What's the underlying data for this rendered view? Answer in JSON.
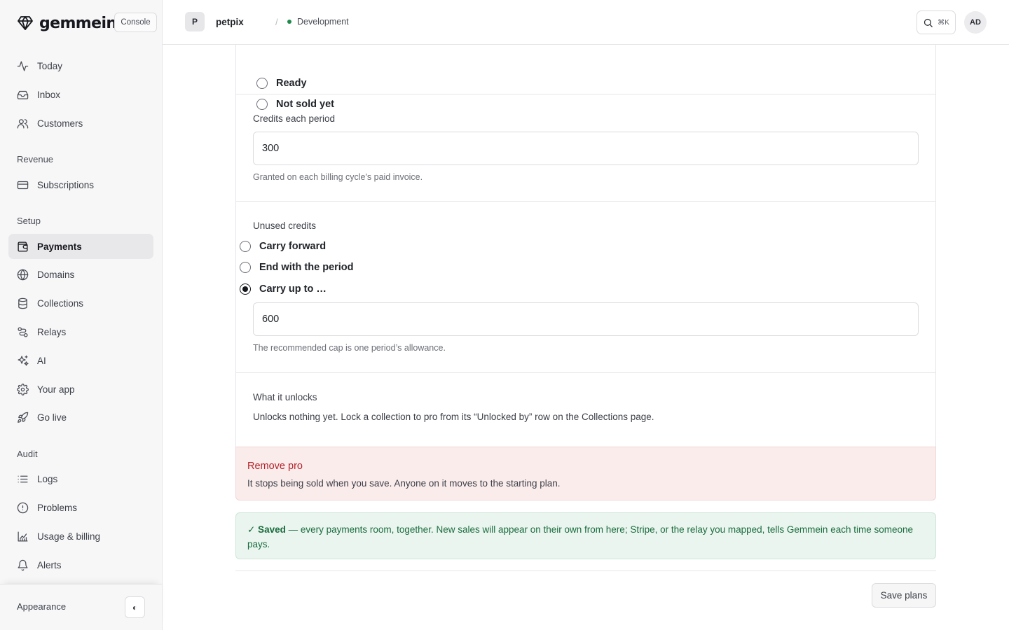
{
  "brand": {
    "name": "gemmein",
    "console_label": "Console",
    "icon": "gem-logo"
  },
  "sidebar": {
    "items_top": [
      {
        "label": "Today",
        "icon": "activity-icon"
      },
      {
        "label": "Inbox",
        "icon": "inbox-icon"
      },
      {
        "label": "Customers",
        "icon": "users-icon"
      }
    ],
    "sections": {
      "revenue": "Revenue",
      "setup": "Setup",
      "audit": "Audit"
    },
    "revenue_items": [
      {
        "label": "Subscriptions",
        "icon": "credit-card-icon"
      }
    ],
    "setup_items": [
      {
        "label": "Payments",
        "icon": "wallet-icon",
        "active": true
      },
      {
        "label": "Domains",
        "icon": "globe-icon"
      },
      {
        "label": "Collections",
        "icon": "database-icon"
      },
      {
        "label": "Relays",
        "icon": "route-icon"
      },
      {
        "label": "AI",
        "icon": "sparkles-icon"
      },
      {
        "label": "Your app",
        "icon": "gear-icon"
      },
      {
        "label": "Go live",
        "icon": "rocket-icon"
      }
    ],
    "audit_items": [
      {
        "label": "Logs",
        "icon": "list-icon"
      },
      {
        "label": "Problems",
        "icon": "alert-circle-icon"
      },
      {
        "label": "Usage & billing",
        "icon": "chart-icon"
      },
      {
        "label": "Alerts",
        "icon": "bell-icon"
      }
    ],
    "footer": {
      "appearance_label": "Appearance",
      "toggle_glyph": "◐"
    }
  },
  "header": {
    "project_initial": "P",
    "project_name": "petpix",
    "separator": "/",
    "environment": "Development",
    "environment_color": "#1f8a4c",
    "search_shortcut": "⌘K",
    "user_initials": "AD"
  },
  "form": {
    "availability_options": [
      {
        "label": "Ready",
        "checked": false
      },
      {
        "label": "Not sold yet",
        "checked": false
      }
    ],
    "credits": {
      "label": "Credits each period",
      "value": "300",
      "hint": "Granted on each billing cycle's paid invoice."
    },
    "unused": {
      "label": "Unused credits",
      "options": [
        {
          "label": "Carry forward",
          "checked": false
        },
        {
          "label": "End with the period",
          "checked": false
        },
        {
          "label": "Carry up to …",
          "checked": true
        }
      ],
      "cap_value": "600",
      "hint": "The recommended cap is one period’s allowance."
    },
    "unlocks": {
      "label": "What it unlocks",
      "text": "Unlocks nothing yet. Lock a collection to pro from its “Unlocked by” row on the Collections page."
    },
    "danger": {
      "title": "Remove pro",
      "text": "It stops being sold when you save. Anyone on it moves to the starting plan."
    }
  },
  "saved_banner": {
    "strong": "✓ Saved",
    "text": " — every payments room, together. New sales will appear on their own from here; Stripe, or the relay you mapped, tells Gemmein each time someone pays."
  },
  "save_button_label": "Save plans"
}
